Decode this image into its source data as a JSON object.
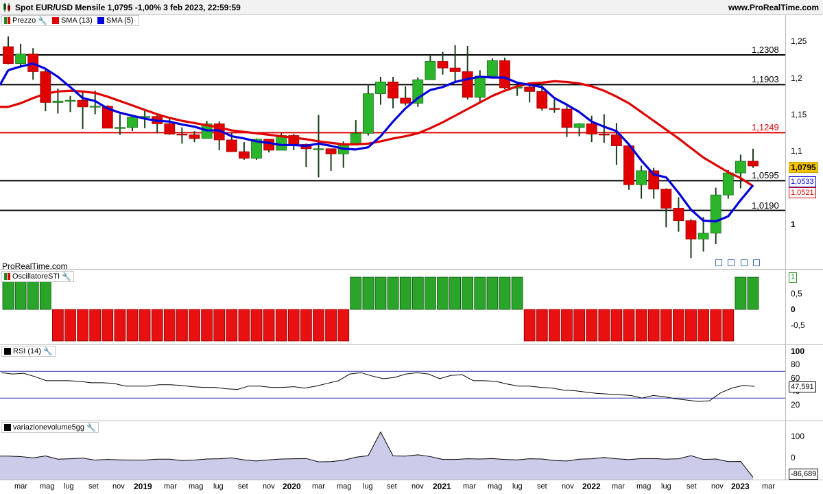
{
  "title": "Spot EUR/USD Mensile 1,0795 -1,00% 3 feb 2023, 22:59:59",
  "site": "www.ProRealTime.com",
  "watermark": "ProRealTime.com",
  "price_panel": {
    "legend": [
      {
        "label": "Prezzo",
        "color": "#1f8a1f"
      },
      {
        "label": "SMA (13)",
        "color": "#e00000"
      },
      {
        "label": "SMA (5)",
        "color": "#0000dd"
      }
    ],
    "y_ticks": [
      "1,25",
      "1,2",
      "1,15",
      "1,1",
      "1"
    ],
    "levels": [
      {
        "label": "1,2308",
        "value": 1.2308,
        "color": "#000000"
      },
      {
        "label": "1,1903",
        "value": 1.1903,
        "color": "#000000"
      },
      {
        "label": "1,1249",
        "value": 1.1249,
        "color": "#e00000"
      },
      {
        "label": "1,0595",
        "value": 1.0595,
        "color": "#000000"
      },
      {
        "label": "1,0190",
        "value": 1.019,
        "color": "#000000"
      }
    ],
    "badges": {
      "price": "1,0795",
      "sma5": "1,0533",
      "sma13": "1,0521"
    }
  },
  "sti_panel": {
    "legend": "OscillatoreSTI",
    "y_ticks": [
      "1",
      "0,5",
      "0",
      "-0,5"
    ]
  },
  "rsi_panel": {
    "legend": "RSI (14)",
    "y_ticks": [
      "100",
      "80",
      "60",
      "40",
      "20"
    ],
    "value_label": "47,591"
  },
  "vol_panel": {
    "legend": "variazionevolume5gg",
    "y_ticks": [
      "100",
      "0"
    ],
    "value_label": "-86,689"
  },
  "x_axis": [
    "mar",
    "mag",
    "lug",
    "set",
    "nov",
    "2019",
    "mar",
    "mag",
    "lug",
    "set",
    "nov",
    "2020",
    "mar",
    "mag",
    "lug",
    "set",
    "nov",
    "2021",
    "mar",
    "mag",
    "lug",
    "set",
    "nov",
    "2022",
    "mar",
    "mag",
    "lug",
    "set",
    "nov",
    "2023",
    "mar"
  ],
  "chart_data": [
    {
      "type": "candlestick",
      "title": "Spot EUR/USD Mensile",
      "x": [
        "2018-02",
        "2018-03",
        "2018-04",
        "2018-05",
        "2018-06",
        "2018-07",
        "2018-08",
        "2018-09",
        "2018-10",
        "2018-11",
        "2018-12",
        "2019-01",
        "2019-02",
        "2019-03",
        "2019-04",
        "2019-05",
        "2019-06",
        "2019-07",
        "2019-08",
        "2019-09",
        "2019-10",
        "2019-11",
        "2019-12",
        "2020-01",
        "2020-02",
        "2020-03",
        "2020-04",
        "2020-05",
        "2020-06",
        "2020-07",
        "2020-08",
        "2020-09",
        "2020-10",
        "2020-11",
        "2020-12",
        "2021-01",
        "2021-02",
        "2021-03",
        "2021-04",
        "2021-05",
        "2021-06",
        "2021-07",
        "2021-08",
        "2021-09",
        "2021-10",
        "2021-11",
        "2021-12",
        "2022-01",
        "2022-02",
        "2022-03",
        "2022-04",
        "2022-05",
        "2022-06",
        "2022-07",
        "2022-08",
        "2022-09",
        "2022-10",
        "2022-11",
        "2022-12",
        "2023-01",
        "2023-02"
      ],
      "open": [
        1.242,
        1.219,
        1.232,
        1.208,
        1.166,
        1.168,
        1.169,
        1.16,
        1.161,
        1.131,
        1.132,
        1.146,
        1.147,
        1.137,
        1.123,
        1.122,
        1.117,
        1.137,
        1.115,
        1.099,
        1.09,
        1.116,
        1.101,
        1.121,
        1.109,
        1.103,
        1.103,
        1.096,
        1.11,
        1.124,
        1.178,
        1.194,
        1.172,
        1.165,
        1.197,
        1.222,
        1.213,
        1.208,
        1.173,
        1.202,
        1.223,
        1.186,
        1.187,
        1.181,
        1.158,
        1.157,
        1.132,
        1.137,
        1.123,
        1.122,
        1.107,
        1.054,
        1.073,
        1.048,
        1.022,
        1.005,
        0.98,
        0.988,
        1.04,
        1.07,
        1.086
      ],
      "high": [
        1.256,
        1.246,
        1.24,
        1.212,
        1.185,
        1.175,
        1.181,
        1.182,
        1.162,
        1.15,
        1.148,
        1.157,
        1.149,
        1.145,
        1.132,
        1.127,
        1.141,
        1.14,
        1.125,
        1.112,
        1.117,
        1.115,
        1.124,
        1.123,
        1.11,
        1.149,
        1.101,
        1.113,
        1.142,
        1.191,
        1.201,
        1.201,
        1.188,
        1.2,
        1.231,
        1.235,
        1.244,
        1.243,
        1.21,
        1.226,
        1.227,
        1.19,
        1.19,
        1.191,
        1.17,
        1.161,
        1.138,
        1.148,
        1.15,
        1.138,
        1.11,
        1.08,
        1.077,
        1.049,
        1.037,
        1.007,
        1.01,
        1.05,
        1.074,
        1.095,
        1.103
      ],
      "low": [
        1.218,
        1.214,
        1.197,
        1.154,
        1.151,
        1.153,
        1.13,
        1.15,
        1.132,
        1.122,
        1.127,
        1.131,
        1.124,
        1.122,
        1.11,
        1.112,
        1.117,
        1.101,
        1.102,
        1.088,
        1.088,
        1.098,
        1.101,
        1.101,
        1.078,
        1.064,
        1.073,
        1.077,
        1.11,
        1.121,
        1.163,
        1.158,
        1.162,
        1.16,
        1.197,
        1.204,
        1.194,
        1.17,
        1.166,
        1.199,
        1.184,
        1.175,
        1.166,
        1.155,
        1.152,
        1.119,
        1.12,
        1.112,
        1.111,
        1.081,
        1.047,
        1.035,
        1.035,
        0.996,
        0.99,
        0.954,
        0.963,
        0.973,
        1.035,
        1.049,
        1.077
      ],
      "close": [
        1.219,
        1.232,
        1.208,
        1.166,
        1.168,
        1.169,
        1.16,
        1.161,
        1.131,
        1.132,
        1.146,
        1.147,
        1.137,
        1.123,
        1.122,
        1.117,
        1.137,
        1.115,
        1.099,
        1.09,
        1.116,
        1.101,
        1.121,
        1.109,
        1.103,
        1.103,
        1.096,
        1.11,
        1.124,
        1.178,
        1.194,
        1.172,
        1.165,
        1.197,
        1.222,
        1.213,
        1.208,
        1.173,
        1.202,
        1.223,
        1.186,
        1.187,
        1.181,
        1.158,
        1.157,
        1.132,
        1.137,
        1.123,
        1.122,
        1.107,
        1.054,
        1.073,
        1.048,
        1.022,
        1.005,
        0.98,
        0.988,
        1.04,
        1.07,
        1.086,
        1.0795
      ],
      "sma13": [
        1.16,
        1.165,
        1.172,
        1.178,
        1.181,
        1.182,
        1.181,
        1.179,
        1.174,
        1.168,
        1.162,
        1.156,
        1.15,
        1.145,
        1.141,
        1.138,
        1.135,
        1.132,
        1.128,
        1.126,
        1.124,
        1.122,
        1.12,
        1.118,
        1.116,
        1.113,
        1.111,
        1.109,
        1.109,
        1.11,
        1.113,
        1.117,
        1.12,
        1.124,
        1.131,
        1.139,
        1.148,
        1.157,
        1.166,
        1.175,
        1.182,
        1.188,
        1.192,
        1.193,
        1.195,
        1.194,
        1.192,
        1.188,
        1.182,
        1.174,
        1.165,
        1.153,
        1.141,
        1.129,
        1.117,
        1.104,
        1.091,
        1.081,
        1.071,
        1.063,
        1.0521
      ],
      "sma5": [
        1.21,
        1.215,
        1.219,
        1.212,
        1.201,
        1.187,
        1.172,
        1.168,
        1.158,
        1.152,
        1.148,
        1.144,
        1.141,
        1.14,
        1.136,
        1.133,
        1.128,
        1.128,
        1.12,
        1.117,
        1.113,
        1.111,
        1.108,
        1.108,
        1.107,
        1.11,
        1.107,
        1.103,
        1.102,
        1.105,
        1.12,
        1.14,
        1.158,
        1.172,
        1.183,
        1.187,
        1.194,
        1.198,
        1.201,
        1.2,
        1.2,
        1.193,
        1.19,
        1.187,
        1.172,
        1.163,
        1.153,
        1.14,
        1.133,
        1.127,
        1.109,
        1.087,
        1.068,
        1.064,
        1.043,
        1.02,
        1.005,
        1.004,
        1.011,
        1.033,
        1.0533
      ],
      "ylim": [
        0.94,
        1.29
      ]
    },
    {
      "type": "bar",
      "title": "OscillatoreSTI",
      "values": [
        1,
        1,
        1,
        1,
        -1,
        -1,
        -1,
        -1,
        -1,
        -1,
        -1,
        -1,
        -1,
        -1,
        -1,
        -1,
        -1,
        -1,
        -1,
        -1,
        -1,
        -1,
        -1,
        -1,
        -1,
        -1,
        -1,
        -1,
        1,
        1,
        1,
        1,
        1,
        1,
        1,
        1,
        1,
        1,
        1,
        1,
        1,
        1,
        -1,
        -1,
        -1,
        -1,
        -1,
        -1,
        -1,
        -1,
        -1,
        -1,
        -1,
        -1,
        -1,
        -1,
        -1,
        -1,
        -1,
        1,
        1
      ],
      "ylim": [
        -1.05,
        1.1
      ]
    },
    {
      "type": "line",
      "title": "RSI (14)",
      "values": [
        68,
        66,
        67,
        62,
        56,
        56,
        56,
        55,
        53,
        53,
        52,
        48,
        48,
        48,
        50,
        50,
        49,
        47,
        46,
        46,
        44,
        43,
        48,
        48,
        46,
        46,
        47,
        45,
        48,
        52,
        56,
        66,
        68,
        63,
        59,
        61,
        66,
        68,
        66,
        59,
        64,
        65,
        56,
        56,
        55,
        51,
        48,
        48,
        46,
        45,
        42,
        41,
        39,
        37,
        36,
        35,
        34,
        30,
        34,
        32,
        29,
        27,
        25,
        26,
        38,
        45,
        49,
        47.591
      ],
      "ylim": [
        0,
        100
      ],
      "bands": [
        70,
        30
      ]
    },
    {
      "type": "area",
      "title": "variazionevolume5gg",
      "values": [
        10,
        8,
        2,
        11,
        -4,
        -2,
        1,
        -8,
        -5,
        -7,
        -8,
        -8,
        -4,
        -4,
        -10,
        -8,
        -3,
        -2,
        2,
        -7,
        -12,
        -7,
        -3,
        -2,
        -1,
        -16,
        -15,
        -9,
        5,
        12,
        120,
        11,
        10,
        16,
        8,
        -5,
        -5,
        -2,
        -3,
        -1,
        -5,
        -7,
        -2,
        -3,
        -10,
        -12,
        -4,
        -2,
        4,
        -2,
        -6,
        -1,
        -1,
        -4,
        -2,
        12,
        -5,
        -3,
        -15,
        -14,
        -86.689
      ],
      "ylim": [
        -95,
        160
      ]
    }
  ]
}
